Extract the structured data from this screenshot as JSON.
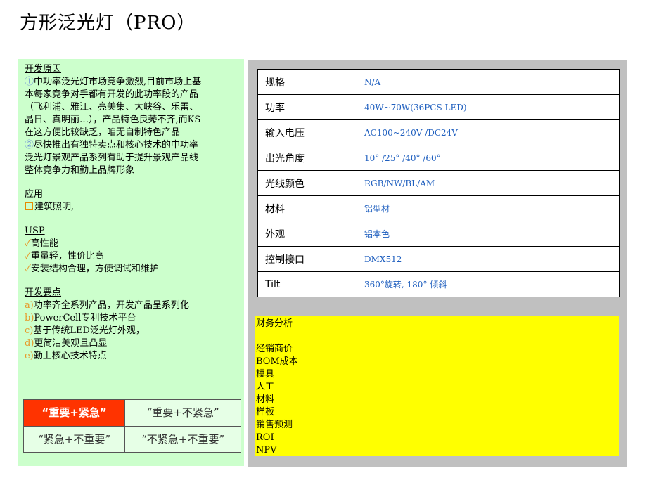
{
  "title": "方形泛光灯（PRO）",
  "left": {
    "dev_reason": {
      "heading": "开发原因",
      "item1_marker": "①",
      "item1_lines": [
        "中功率泛光灯市场竞争激烈,目前市场上基",
        "本每家竞争对手都有开发的此功率段的产品",
        "（飞利浦、雅江、亮美集、大峡谷、乐雷、",
        "晶日、真明丽…），产品特色良莠不齐,而KS",
        "在这方便比较缺乏，咱无自制特色产品"
      ],
      "item2_marker": "②",
      "item2_lines": [
        "尽快推出有独特卖点和核心技术的中功率",
        "泛光灯景观产品系列有助于提升景观产品线",
        "整体竞争力和勤上品牌形象"
      ]
    },
    "application": {
      "heading": "应用",
      "item": "建筑照明,"
    },
    "usp": {
      "heading": "USP",
      "items": [
        "高性能",
        "重量轻，性价比高",
        "安装结构合理，方便调试和维护"
      ]
    },
    "key_points": {
      "heading": "开发要点",
      "items": [
        {
          "marker": "a)",
          "text": "功率齐全系列产品，开发产品呈系列化"
        },
        {
          "marker": "b)",
          "text": "PowerCell专利技术平台"
        },
        {
          "marker": "c)",
          "text": "基于传统LED泛光灯外观，"
        },
        {
          "marker": "d)",
          "text": "更简洁美观且凸显"
        },
        {
          "marker": "e)",
          "text": "勤上核心技术特点"
        }
      ]
    },
    "matrix": {
      "tl": "“重要+紧急”",
      "tr": "“重要+不紧急”",
      "bl": "“紧急+不重要”",
      "br": "“不紧急+不重要”"
    }
  },
  "specs": [
    {
      "label": "规格",
      "value": "N/A"
    },
    {
      "label": "功率",
      "value": "40W~70W(36PCS LED)"
    },
    {
      "label": "输入电压",
      "value": "AC100~240V /DC24V"
    },
    {
      "label": "出光角度",
      "value": "10° /25° /40° /60°"
    },
    {
      "label": "光线颜色",
      "value": "RGB/NW/BL/AM"
    },
    {
      "label": "材料",
      "value": "铝型材"
    },
    {
      "label": "外观",
      "value": "铝本色"
    },
    {
      "label": "控制接口",
      "value": "DMX512"
    },
    {
      "label": "Tilt",
      "value": "360°旋转, 180° 倾斜"
    }
  ],
  "finance": {
    "heading": "财务分析",
    "items": [
      "经销商价",
      "BOM成本",
      "模具",
      "人工",
      "材料",
      "样板",
      "销售预测",
      "ROI",
      "NPV"
    ]
  },
  "colors": {
    "left_panel_bg": "#ccffcc",
    "right_panel_bg": "#c0c0c0",
    "finance_bg": "#ffff00",
    "urgent_cell": "#ff3300",
    "spec_value_text": "#1f5fbf"
  }
}
